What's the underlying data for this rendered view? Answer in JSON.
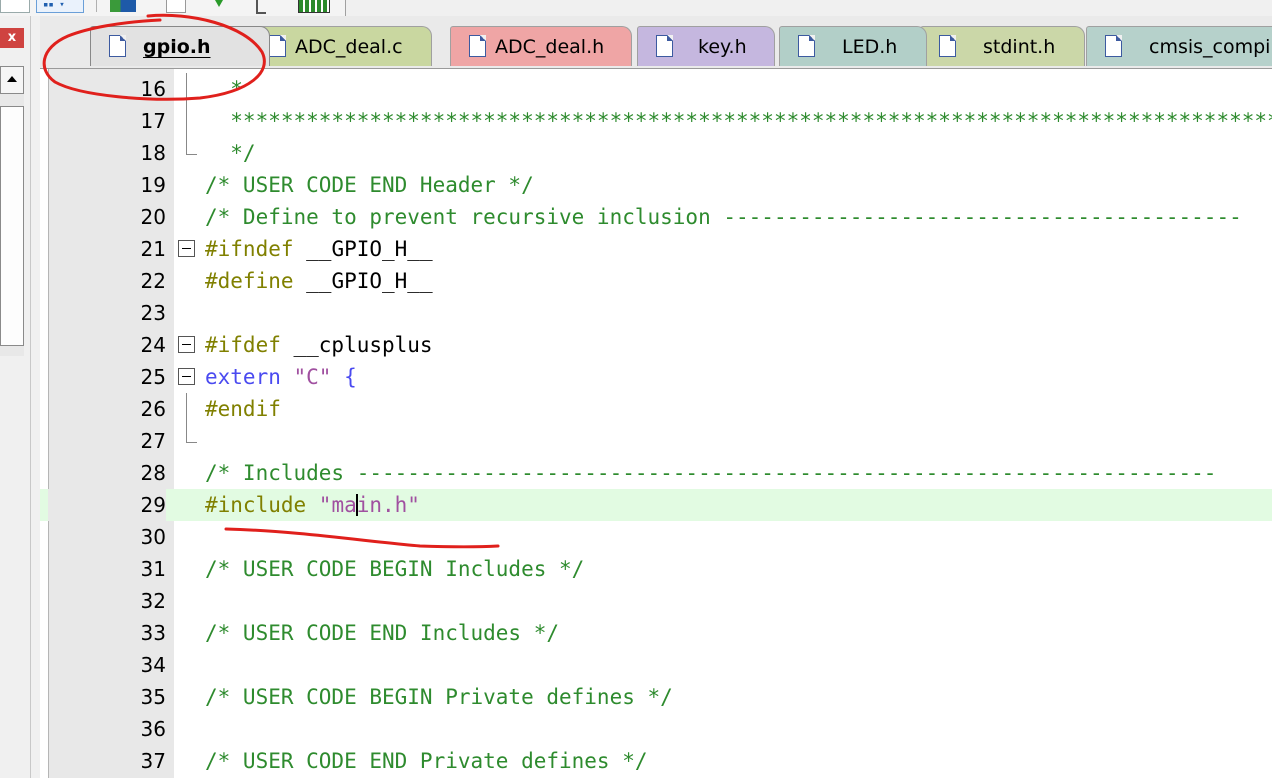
{
  "window": {
    "close_glyph": "x"
  },
  "tabs": [
    {
      "label": "gpio.h",
      "active": true,
      "color": "#e2e2e2"
    },
    {
      "label": "ADC_deal.c",
      "active": false,
      "color": "#c9d7a0"
    },
    {
      "label": "ADC_deal.h",
      "active": false,
      "color": "#efa5a5"
    },
    {
      "label": "key.h",
      "active": false,
      "color": "#c5b7df"
    },
    {
      "label": "LED.h",
      "active": false,
      "color": "#b2cfc8"
    },
    {
      "label": "stdint.h",
      "active": false,
      "color": "#cbd7a8"
    },
    {
      "label": "cmsis_compi",
      "active": false,
      "color": "#b6d1cb"
    }
  ],
  "editor": {
    "current_line": 29,
    "lines": [
      {
        "n": "16",
        "text": "  *"
      },
      {
        "n": "17",
        "text": "  ************************************************************************************"
      },
      {
        "n": "18",
        "text": "  */"
      },
      {
        "n": "19",
        "text": "/* USER CODE END Header */"
      },
      {
        "n": "20",
        "text": "/* Define to prevent recursive inclusion -----------------------------------------"
      },
      {
        "n": "21",
        "pp": "#ifndef",
        "ident": " __GPIO_H__"
      },
      {
        "n": "22",
        "pp": "#define",
        "ident": " __GPIO_H__"
      },
      {
        "n": "23",
        "text": ""
      },
      {
        "n": "24",
        "pp": "#ifdef",
        "ident": " __cplusplus"
      },
      {
        "n": "25",
        "kw": "extern",
        "str": " \"C\"",
        "punc": " {"
      },
      {
        "n": "26",
        "pp": "#endif"
      },
      {
        "n": "27",
        "text": ""
      },
      {
        "n": "28",
        "text": "/* Includes --------------------------------------------------------------------"
      },
      {
        "n": "29",
        "pp": "#include",
        "str_pre": " \"ma",
        "str_post": "in.h\""
      },
      {
        "n": "30",
        "text": ""
      },
      {
        "n": "31",
        "text": "/* USER CODE BEGIN Includes */"
      },
      {
        "n": "32",
        "text": ""
      },
      {
        "n": "33",
        "text": "/* USER CODE END Includes */"
      },
      {
        "n": "34",
        "text": ""
      },
      {
        "n": "35",
        "text": "/* USER CODE BEGIN Private defines */"
      },
      {
        "n": "36",
        "text": ""
      },
      {
        "n": "37",
        "text": "/* USER CODE END Private defines */"
      }
    ]
  },
  "annotation_color": "#e0201c"
}
